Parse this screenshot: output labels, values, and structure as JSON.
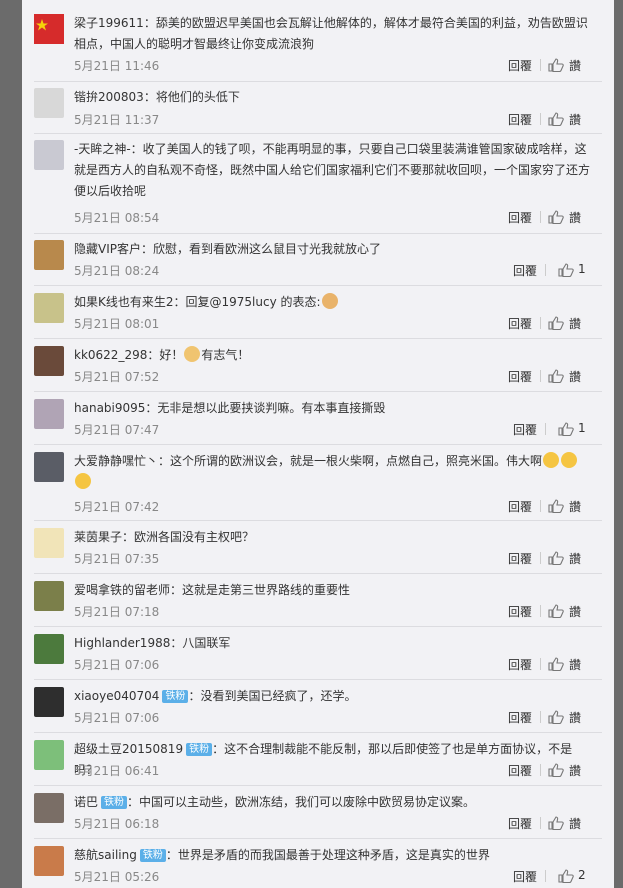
{
  "labels": {
    "reply": "回覆",
    "like": "讚"
  },
  "comments": [
    {
      "user": "梁子199611",
      "text": "：舔美的欧盟迟早美国也会瓦解让他解体的，解体才最符合美国的利益，劝告欧盟识相点，中国人的聪明才智最终让你变成流浪狗",
      "time": "5月21日 11:46",
      "likes": "讚",
      "avatar_color": "#d62b2b"
    },
    {
      "user": "锴拚200803",
      "text": "：将他们的头低下",
      "time": "5月21日 11:37",
      "likes": "讚",
      "avatar_color": "#d8d8d8"
    },
    {
      "user": "-天眸之神-",
      "text": "：收了美国人的钱了呗，不能再明显的事，只要自己口袋里装满谁管国家破成啥样，这就是西方人的自私观不奇怪，既然中国人给它们国家福利它们不要那就收回呗，一个国家穷了还方便以后收拾呢",
      "time": "5月21日 08:54",
      "likes": "讚",
      "avatar_color": "#c9c9d2"
    },
    {
      "user": "隐藏VIP客户",
      "text": "：欣慰，看到看欧洲这么鼠目寸光我就放心了",
      "time": "5月21日 08:24",
      "likes": "1",
      "avatar_color": "#b8894c"
    },
    {
      "user": "如果K线也有来生2",
      "text": "：回复@1975lucy 的表态:",
      "time": "5月21日 08:01",
      "likes": "讚",
      "avatar_color": "#c8c28a"
    },
    {
      "user": "kk0622_298",
      "text": "：好！",
      "extra": "有志气！",
      "time": "5月21日 07:52",
      "likes": "讚",
      "avatar_color": "#6a4a3a"
    },
    {
      "user": "hanabi9095",
      "text": "：无非是想以此要挟谈判嘛。有本事直接撕毁",
      "time": "5月21日 07:47",
      "likes": "1",
      "avatar_color": "#b0a4b5"
    },
    {
      "user": "大爱静静嘿忙丶",
      "text": "：这个所谓的欧洲议会，就是一根火柴啊，点燃自己，照亮米国。伟大啊",
      "time": "5月21日 07:42",
      "likes": "讚",
      "avatar_color": "#5a5d66"
    },
    {
      "user": "莱茵果子",
      "text": "：欧洲各国没有主权吧？",
      "time": "5月21日 07:35",
      "likes": "讚",
      "avatar_color": "#f1e4b8"
    },
    {
      "user": "爱喝拿铁的留老师",
      "text": "：这就是走第三世界路线的重要性",
      "time": "5月21日 07:18",
      "likes": "讚",
      "avatar_color": "#7b7f4a"
    },
    {
      "user": "Highlander1988",
      "text": "：八国联军",
      "time": "5月21日 07:06",
      "likes": "讚",
      "avatar_color": "#4c7a3d"
    },
    {
      "user": "xiaoye040704",
      "badge": "铁粉",
      "text": "：没看到美国已经疯了，还学。",
      "time": "5月21日 07:06",
      "likes": "讚",
      "avatar_color": "#2e2e2e"
    },
    {
      "user": "超级土豆20150819",
      "badge": "铁粉",
      "text": "：这不合理制裁能不能反制，那以后即使签了也是单方面协议，不是吗？",
      "time": "5月21日 06:41",
      "likes": "讚",
      "avatar_color": "#7dbf7a"
    },
    {
      "user": "诺巴",
      "badge": "铁粉",
      "text": "：中国可以主动些，欧洲冻结，我们可以废除中欧贸易协定议案。",
      "time": "5月21日 06:18",
      "likes": "讚",
      "avatar_color": "#7a6e66"
    },
    {
      "user": "慈航sailing",
      "badge": "铁粉",
      "text": "：世界是矛盾的而我国最善于处理这种矛盾，这是真实的世界",
      "time": "5月21日 05:26",
      "likes": "2",
      "avatar_color": "#c97b4a"
    }
  ]
}
